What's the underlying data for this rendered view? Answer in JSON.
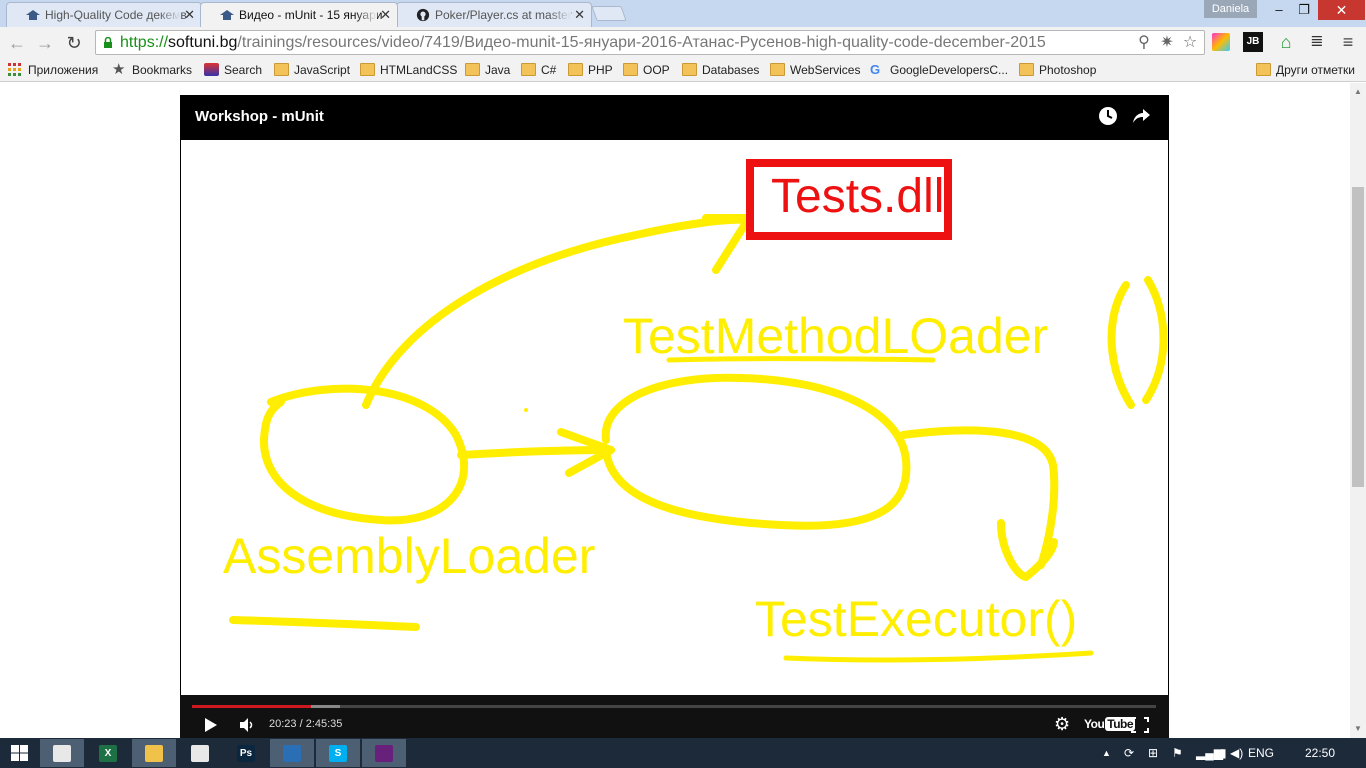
{
  "browser": {
    "tabs": [
      {
        "title": "High-Quality Code декемв",
        "active": false,
        "favicon": "softuni-icon"
      },
      {
        "title": "Видео - mUnit - 15 януари",
        "active": true,
        "favicon": "softuni-icon"
      },
      {
        "title": "Poker/Player.cs at master",
        "active": false,
        "favicon": "github-icon"
      }
    ],
    "profile_name": "Daniela",
    "url": {
      "scheme": "https://",
      "host": "softuni.bg",
      "path": "/trainings/resources/video/7419/Видео-munit-15-януари-2016-Атанас-Русенов-high-quality-code-december-2015"
    },
    "bookmarks": [
      {
        "label": "Приложения",
        "icon": "apps-grid-icon"
      },
      {
        "label": "Bookmarks",
        "icon": "star-icon"
      },
      {
        "label": "Search",
        "icon": "search-extension-icon"
      },
      {
        "label": "JavaScript",
        "icon": "folder-icon"
      },
      {
        "label": "HTMLandCSS",
        "icon": "folder-icon"
      },
      {
        "label": "Java",
        "icon": "folder-icon"
      },
      {
        "label": "C#",
        "icon": "folder-icon"
      },
      {
        "label": "PHP",
        "icon": "folder-icon"
      },
      {
        "label": "OOP",
        "icon": "folder-icon"
      },
      {
        "label": "Databases",
        "icon": "folder-icon"
      },
      {
        "label": "WebServices",
        "icon": "folder-icon"
      },
      {
        "label": "GoogleDevelopersC...",
        "icon": "google-icon"
      },
      {
        "label": "Photoshop",
        "icon": "folder-icon"
      }
    ],
    "other_bookmarks": "Други отметки"
  },
  "player": {
    "title": "Workshop - mUnit",
    "current_time": "20:23",
    "duration": "2:45:35",
    "time_display": "20:23 / 2:45:35",
    "played_fraction": 0.123,
    "buffered_fraction": 0.154,
    "youtube_label": "You",
    "youtube_tube": "Tube"
  },
  "whiteboard": {
    "labels": {
      "tests_dll": "Tests.dll",
      "method_loader": "TestMethodLOader",
      "assembly_loader": "AssemblyLoader",
      "executor": "TestExecutor()"
    },
    "colors": {
      "ink": "#ffee00",
      "box": "#ee1111"
    }
  },
  "taskbar": {
    "apps": [
      {
        "name": "chrome",
        "label": "",
        "color": "#e8e8e8",
        "active": true
      },
      {
        "name": "excel",
        "label": "X",
        "color": "#1e7145",
        "active": false
      },
      {
        "name": "file-explorer",
        "label": "",
        "color": "#f0c24a",
        "active": true
      },
      {
        "name": "calculator",
        "label": "",
        "color": "#e8e8e8",
        "active": false
      },
      {
        "name": "photoshop",
        "label": "Ps",
        "color": "#0b2740",
        "active": false
      },
      {
        "name": "browser-globe",
        "label": "",
        "color": "#2a6fb5",
        "active": true
      },
      {
        "name": "skype",
        "label": "S",
        "color": "#00aff0",
        "active": true
      },
      {
        "name": "visual-studio",
        "label": "",
        "color": "#68217a",
        "active": true
      }
    ],
    "language": "ENG",
    "clock": "22:50"
  }
}
